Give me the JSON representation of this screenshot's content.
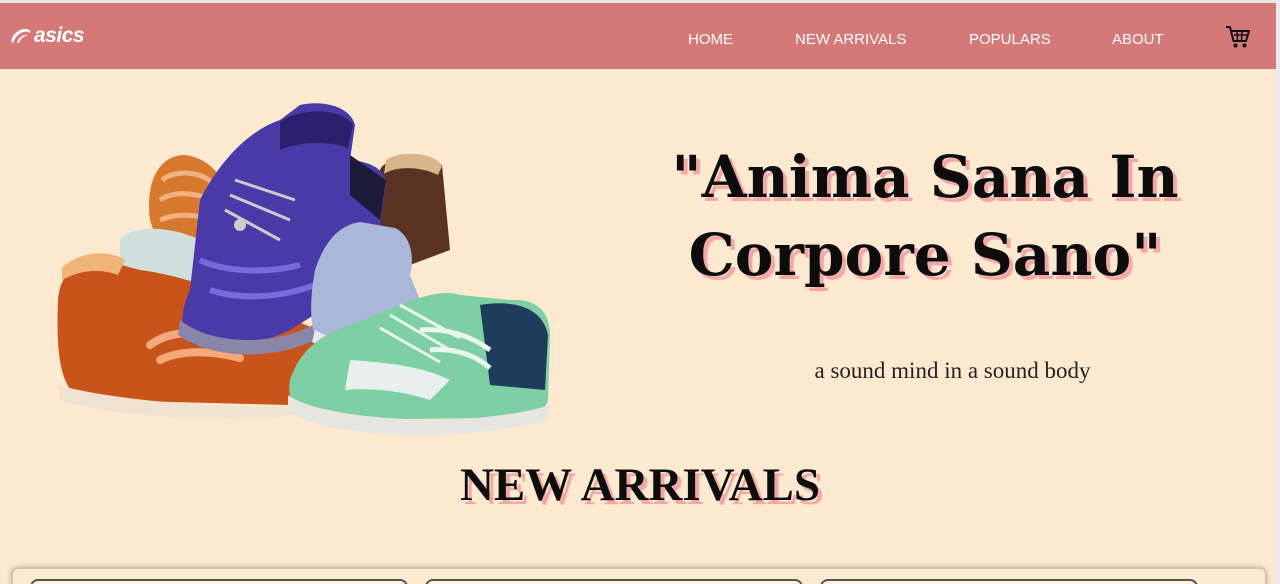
{
  "brand": {
    "logo_text": "asics"
  },
  "nav": {
    "items": [
      {
        "label": "HOME"
      },
      {
        "label": "NEW ARRIVALS"
      },
      {
        "label": "POPULARS"
      },
      {
        "label": "ABOUT"
      }
    ],
    "cart_icon": "shopping-cart-icon"
  },
  "hero": {
    "title_line1": "\"Anima Sana In",
    "title_line2": "Corpore Sano\"",
    "subtitle": "a sound mind in a sound body",
    "image": "sneakers-stack-image"
  },
  "sections": {
    "new_arrivals_title": "NEW ARRIVALS"
  },
  "colors": {
    "navbar": "#d47878",
    "background": "#fde9cf",
    "title_shadow": "#f2a8a8"
  }
}
